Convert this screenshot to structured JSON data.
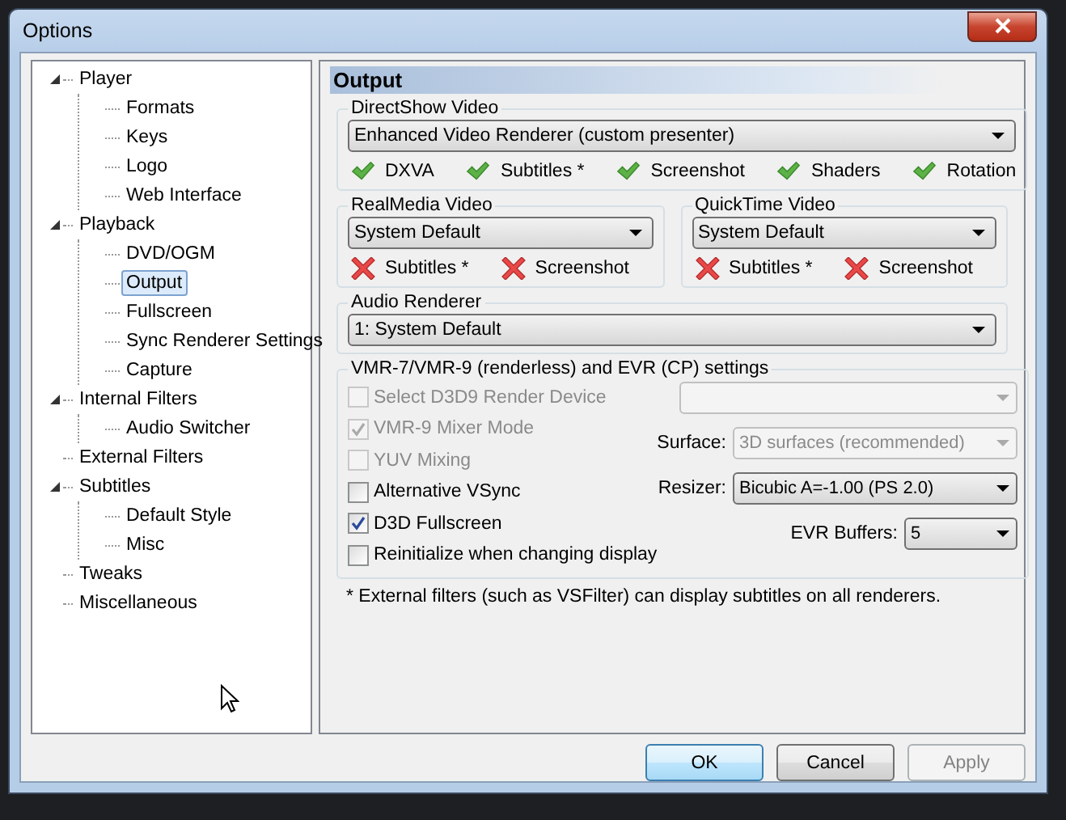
{
  "window": {
    "title": "Options"
  },
  "tree": [
    {
      "label": "Player",
      "expanded": true,
      "selected": false,
      "children": [
        {
          "label": "Formats",
          "selected": false
        },
        {
          "label": "Keys",
          "selected": false
        },
        {
          "label": "Logo",
          "selected": false
        },
        {
          "label": "Web Interface",
          "selected": false
        }
      ]
    },
    {
      "label": "Playback",
      "expanded": true,
      "selected": false,
      "children": [
        {
          "label": "DVD/OGM",
          "selected": false
        },
        {
          "label": "Output",
          "selected": true
        },
        {
          "label": "Fullscreen",
          "selected": false
        },
        {
          "label": "Sync Renderer Settings",
          "selected": false
        },
        {
          "label": "Capture",
          "selected": false
        }
      ]
    },
    {
      "label": "Internal Filters",
      "expanded": true,
      "selected": false,
      "children": [
        {
          "label": "Audio Switcher",
          "selected": false
        }
      ]
    },
    {
      "label": "External Filters",
      "selected": false
    },
    {
      "label": "Subtitles",
      "expanded": true,
      "selected": false,
      "children": [
        {
          "label": "Default Style",
          "selected": false
        },
        {
          "label": "Misc",
          "selected": false
        }
      ]
    },
    {
      "label": "Tweaks",
      "selected": false
    },
    {
      "label": "Miscellaneous",
      "selected": false
    }
  ],
  "page": {
    "title": "Output",
    "directshow": {
      "title": "DirectShow Video",
      "value": "Enhanced Video Renderer (custom presenter)",
      "features": [
        {
          "label": "DXVA",
          "supported": true
        },
        {
          "label": "Subtitles *",
          "supported": true
        },
        {
          "label": "Screenshot",
          "supported": true
        },
        {
          "label": "Shaders",
          "supported": true
        },
        {
          "label": "Rotation",
          "supported": true
        }
      ]
    },
    "realmedia": {
      "title": "RealMedia Video",
      "value": "System Default",
      "features": [
        {
          "label": "Subtitles *",
          "supported": false
        },
        {
          "label": "Screenshot",
          "supported": false
        }
      ]
    },
    "quicktime": {
      "title": "QuickTime Video",
      "value": "System Default",
      "features": [
        {
          "label": "Subtitles *",
          "supported": false
        },
        {
          "label": "Screenshot",
          "supported": false
        }
      ]
    },
    "audio": {
      "title": "Audio Renderer",
      "value": "1: System Default"
    },
    "vmr": {
      "title": "VMR-7/VMR-9 (renderless) and EVR (CP) settings",
      "checkboxes": [
        {
          "label": "Select D3D9 Render Device",
          "checked": false,
          "disabled": true
        },
        {
          "label": "VMR-9 Mixer Mode",
          "checked": true,
          "disabled": true
        },
        {
          "label": "YUV Mixing",
          "checked": false,
          "disabled": true
        },
        {
          "label": "Alternative VSync",
          "checked": false,
          "disabled": false
        },
        {
          "label": "D3D Fullscreen",
          "checked": true,
          "disabled": false
        },
        {
          "label": "Reinitialize when changing display",
          "checked": false,
          "disabled": false
        }
      ],
      "combos": [
        {
          "disabled": true
        },
        {
          "label": "Surface:",
          "value": "3D surfaces (recommended)",
          "disabled": true
        },
        {
          "label": "Resizer:",
          "value": "Bicubic A=-1.00 (PS 2.0)",
          "disabled": false
        },
        {
          "label": "EVR Buffers:",
          "value": "5",
          "disabled": false
        }
      ]
    },
    "footnote": "* External filters (such as VSFilter) can display subtitles on all renderers."
  },
  "buttons": [
    {
      "label": "OK",
      "kind": "default",
      "disabled": false
    },
    {
      "label": "Cancel",
      "kind": "normal",
      "disabled": false
    },
    {
      "label": "Apply",
      "kind": "normal",
      "disabled": true
    }
  ]
}
